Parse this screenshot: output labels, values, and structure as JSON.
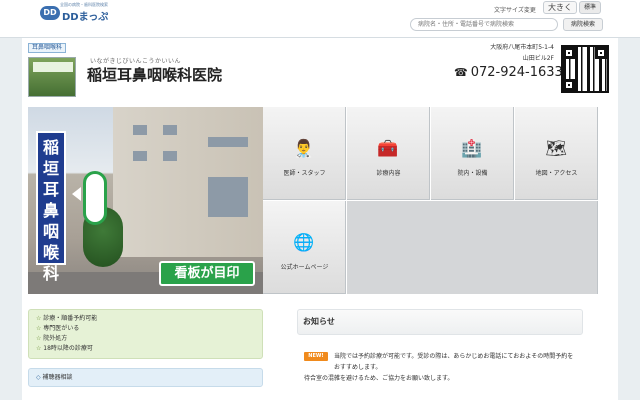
{
  "site": {
    "tagline": "全国の病院・歯科医院検索",
    "logo_mark": "DD",
    "logo_name": "DDまっぷ"
  },
  "header": {
    "font_size_label": "文字サイズ変更",
    "font_large": "大きく",
    "font_standard": "標準",
    "search_placeholder": "病院名・住所・電話番号で病院検索",
    "search_button": "病院検索"
  },
  "clinic": {
    "category": "耳鼻咽喉科",
    "furigana": "いながきじびいんこうかいいん",
    "name": "稲垣耳鼻咽喉科医院",
    "address_line1": "大阪府八尾市本町5-1-4",
    "address_line2": "山田ビル2F",
    "phone": "072-924-1633"
  },
  "hero": {
    "vertical_sign": "稲垣耳鼻咽喉科",
    "caption": "看板が目印"
  },
  "tiles": [
    {
      "label": "医師・スタッフ",
      "icon": "doctor-icon",
      "glyph": "👨‍⚕️"
    },
    {
      "label": "診療内容",
      "icon": "medical-kit-icon",
      "glyph": "🧰"
    },
    {
      "label": "院内・設備",
      "icon": "hospital-icon",
      "glyph": "🏥"
    },
    {
      "label": "地図・アクセス",
      "icon": "map-icon",
      "glyph": "🗺"
    },
    {
      "label": "公式ホームページ",
      "icon": "globe-icon",
      "glyph": "🌐"
    }
  ],
  "features": [
    "診療・順番予約可能",
    "専門医がいる",
    "院外処方",
    "18時以降の診療可"
  ],
  "support_label": "補聴器相談",
  "notice": {
    "title": "お知らせ",
    "badge": "NEW!",
    "body1": "当院では予約診療が可能です。受診の際は、あらかじめお電話にておおよその時間予約をおすすめします。",
    "body2": "待合室の混雑を避けるため、ご協力をお願い致します。"
  },
  "colors": {
    "accent_blue": "#2b5d9a",
    "sign_blue": "#1f3c8f",
    "sign_green": "#2aa24a",
    "feature_bg": "#e6f2d6",
    "new_badge": "#f08a1c"
  }
}
